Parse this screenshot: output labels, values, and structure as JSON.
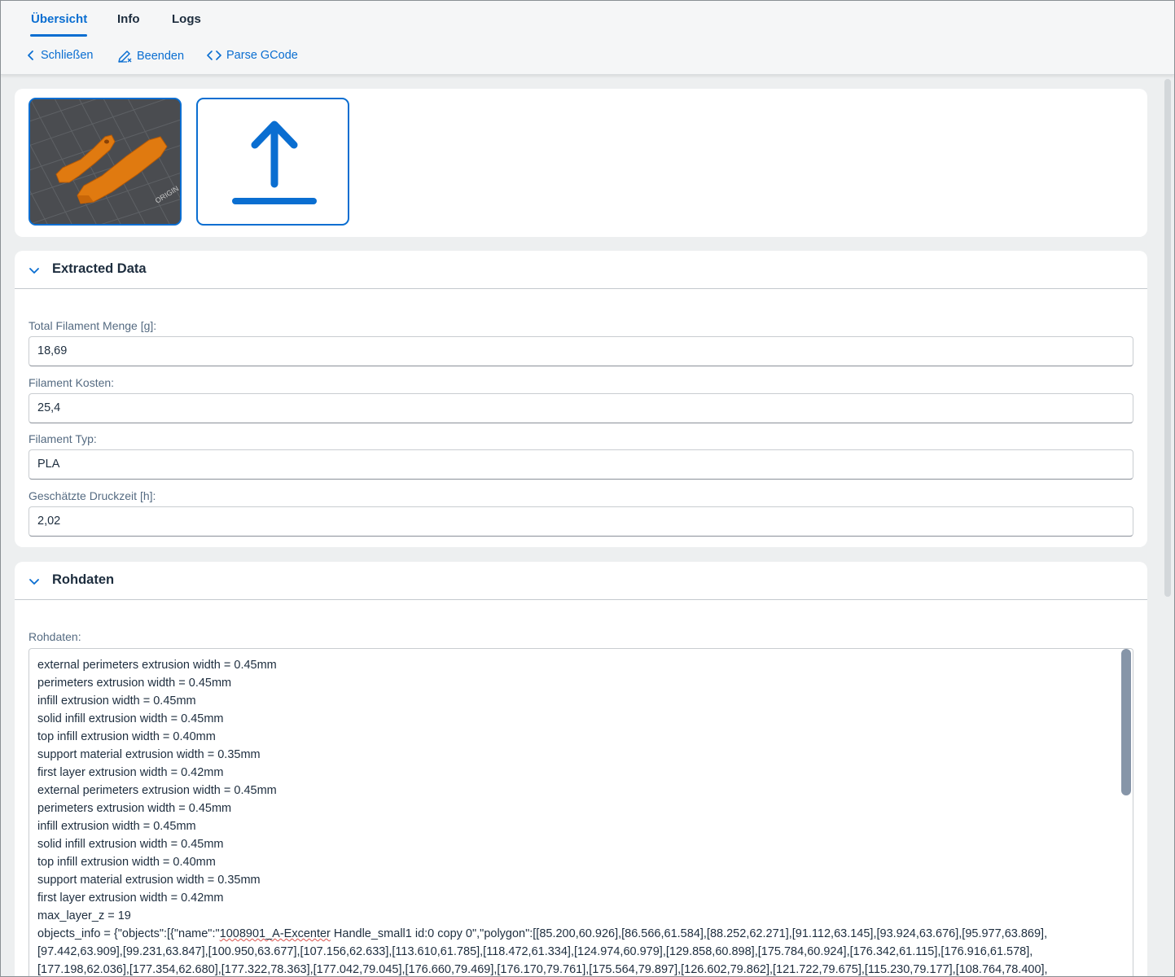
{
  "tabs": [
    {
      "label": "Übersicht",
      "active": true
    },
    {
      "label": "Info",
      "active": false
    },
    {
      "label": "Logs",
      "active": false
    }
  ],
  "actions": {
    "close_label": "Schließen",
    "end_label": "Beenden",
    "parse_label": "Parse GCode"
  },
  "images": {
    "preview_icon": "3d-print-preview",
    "preview_watermark": "ORIGIN",
    "upload_icon": "upload-icon"
  },
  "extracted": {
    "title": "Extracted Data",
    "fields": [
      {
        "label": "Total Filament Menge [g]:",
        "value": "18,69"
      },
      {
        "label": "Filament Kosten:",
        "value": "25,4"
      },
      {
        "label": "Filament Typ:",
        "value": "PLA"
      },
      {
        "label": "Geschätzte Druckzeit [h]:",
        "value": "2,02"
      }
    ]
  },
  "raw": {
    "title": "Rohdaten",
    "label": "Rohdaten:",
    "lines": [
      "external perimeters extrusion width = 0.45mm",
      "perimeters extrusion width = 0.45mm",
      "infill extrusion width = 0.45mm",
      "solid infill extrusion width = 0.45mm",
      "top infill extrusion width = 0.40mm",
      "support material extrusion width = 0.35mm",
      "first layer extrusion width = 0.42mm",
      "external perimeters extrusion width = 0.45mm",
      "perimeters extrusion width = 0.45mm",
      "infill extrusion width = 0.45mm",
      "solid infill extrusion width = 0.45mm",
      "top infill extrusion width = 0.40mm",
      "support material extrusion width = 0.35mm",
      "first layer extrusion width = 0.42mm",
      "max_layer_z = 19"
    ],
    "objects_prefix": "objects_info = {\"objects\":[{\"name\":\"",
    "objects_name": "1008901_A-Excenter",
    "objects_suffix": " Handle_small1 id:0 copy 0\",\"polygon\":[[85.200,60.926],[86.566,61.584],[88.252,62.271],[91.112,63.145],[93.924,63.676],[95.977,63.869],",
    "cont_lines": [
      "[97.442,63.909],[99.231,63.847],[100.950,63.677],[107.156,62.633],[113.610,61.785],[118.472,61.334],[124.974,60.979],[129.858,60.898],[175.784,60.924],[176.342,61.115],[176.916,61.578],",
      "[177.198,62.036],[177.354,62.680],[177.322,78.363],[177.042,79.045],[176.660,79.469],[176.170,79.761],[175.564,79.897],[126.602,79.862],[121.722,79.675],[115.230,79.177],[108.764,78.400],"
    ]
  }
}
